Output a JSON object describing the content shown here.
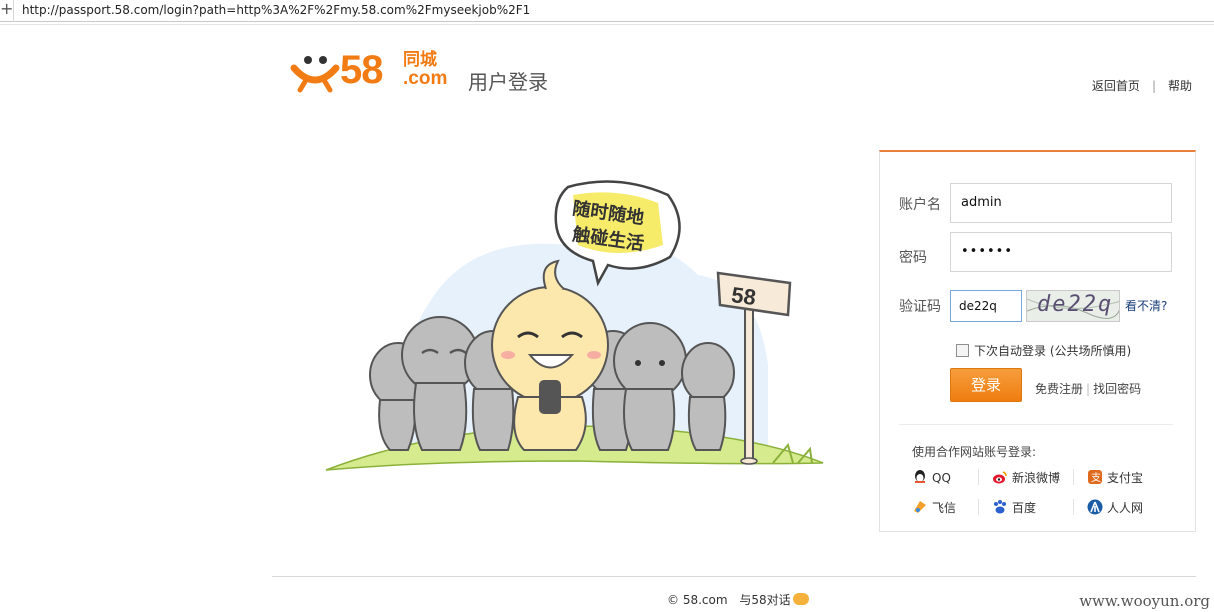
{
  "browser": {
    "url": "http://passport.58.com/login?path=http%3A%2F%2Fmy.58.com%2Fmyseekjob%2F1"
  },
  "brand": {
    "number": "58",
    "cn": "同城",
    "com": ".com",
    "page_title": "用户登录"
  },
  "nav": {
    "home": "返回首页",
    "sep": "|",
    "help": "帮助"
  },
  "illustration": {
    "bubble_line1": "随时随地",
    "bubble_line2": "触碰生活",
    "sign": "58"
  },
  "form": {
    "username_label": "账户名",
    "username_value": "admin",
    "password_label": "密码",
    "password_value": "••••••",
    "captcha_label": "验证码",
    "captcha_value": "de22q",
    "captcha_image_text": "de22q",
    "captcha_refresh": "看不清?",
    "remember_label": "下次自动登录 (公共场所慎用)",
    "login_button": "登录",
    "register_link": "免费注册",
    "link_sep": "|",
    "forgot_link": "找回密码"
  },
  "partners": {
    "title": "使用合作网站账号登录:",
    "items": [
      {
        "label": "QQ",
        "icon": "qq-icon",
        "color": "#1a8de6"
      },
      {
        "label": "新浪微博",
        "icon": "weibo-icon",
        "color": "#e6162d"
      },
      {
        "label": "支付宝",
        "icon": "alipay-icon",
        "color": "#e06b1f"
      },
      {
        "label": "飞信",
        "icon": "fetion-icon",
        "color": "#f3a12b"
      },
      {
        "label": "百度",
        "icon": "baidu-icon",
        "color": "#2e61d0"
      },
      {
        "label": "人人网",
        "icon": "renren-icon",
        "color": "#1a5da6"
      }
    ]
  },
  "footer": {
    "copyright": "© 58.com",
    "talk": "与58对话"
  },
  "watermark": "www.wooyun.org",
  "colors": {
    "brand_orange": "#f27b13",
    "button_orange": "#ee7d10",
    "panel_top": "#ea7f3c"
  }
}
